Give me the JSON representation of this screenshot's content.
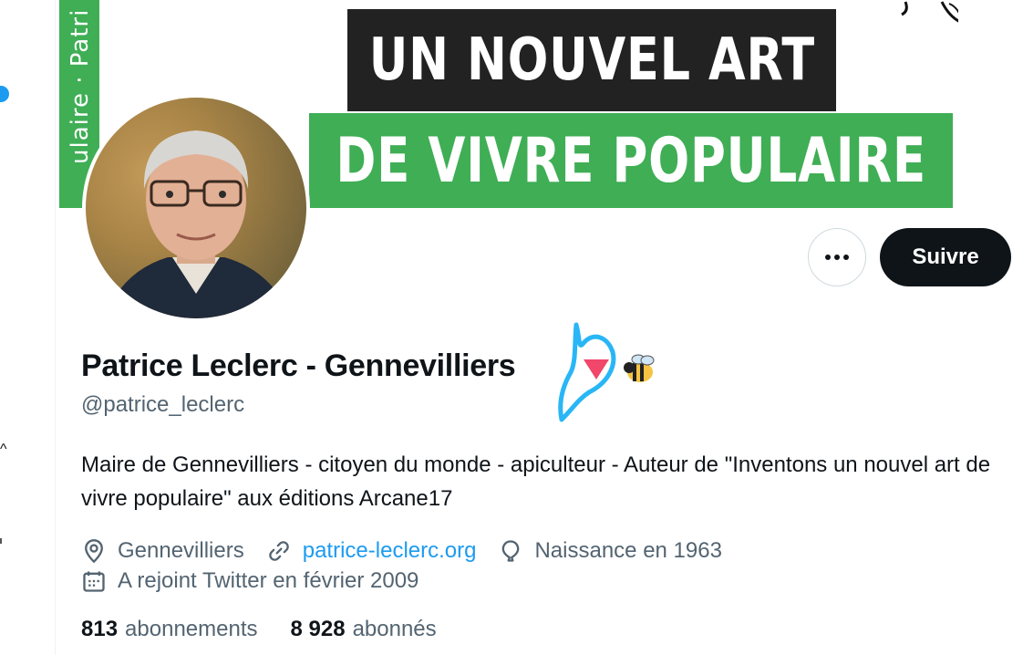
{
  "banner": {
    "strip_text": "ulaire · Patri",
    "line1": "UN NOUVEL ART",
    "line2": "DE VIVRE POPULAIRE",
    "colors": {
      "green": "#3fae55",
      "black": "#222222"
    }
  },
  "actions": {
    "more_icon": "more-horizontal-icon",
    "follow_label": "Suivre"
  },
  "profile": {
    "display_name": "Patrice Leclerc - Gennevilliers",
    "name_emojis": [
      "red-triangle-down-emoji",
      "bee-emoji"
    ],
    "handle": "@patrice_leclerc",
    "bio": "Maire de Gennevilliers - citoyen du monde - apiculteur - Auteur de \"Inventons un nouvel art de vivre populaire\" aux éditions Arcane17",
    "location": "Gennevilliers",
    "website": "patrice-leclerc.org",
    "birth": "Naissance en 1963",
    "joined": "A rejoint Twitter en février 2009"
  },
  "stats": {
    "following_count": "813",
    "following_label": "abonnements",
    "followers_count": "8 928",
    "followers_label": "abonnés"
  },
  "colors": {
    "text_primary": "#0f1419",
    "text_secondary": "#536471",
    "accent": "#1d9bf0",
    "annotation": "#29b6f6"
  }
}
